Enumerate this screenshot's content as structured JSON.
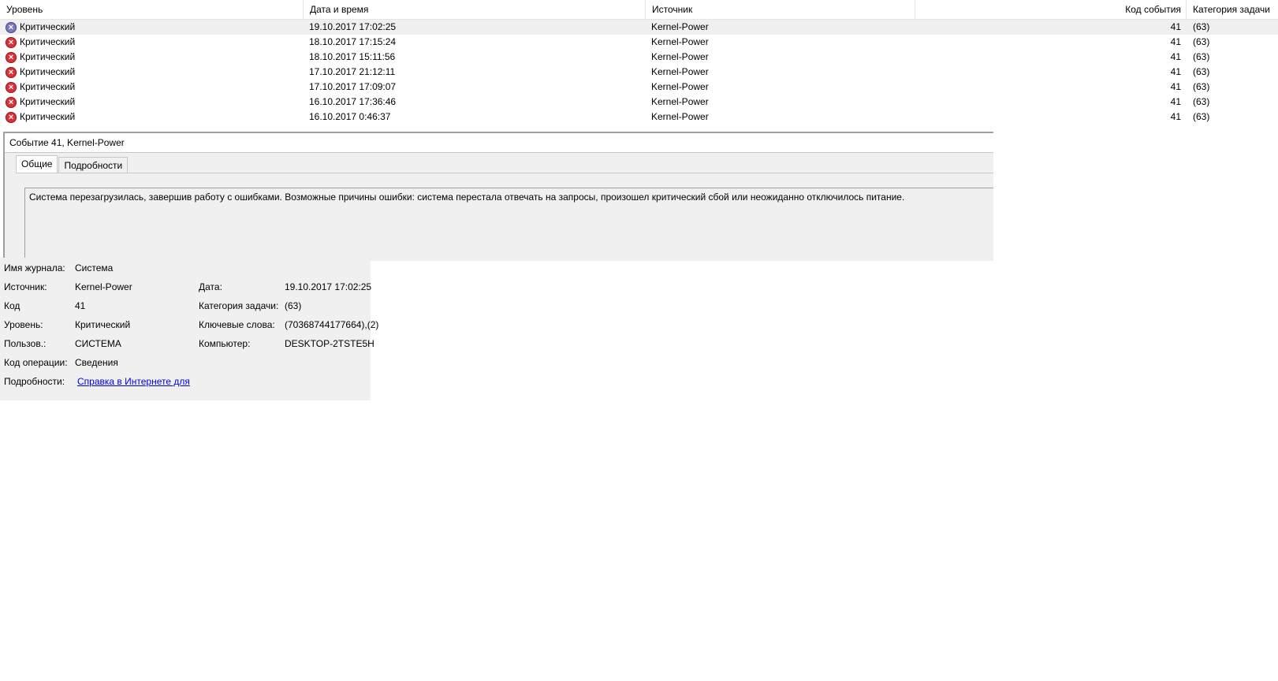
{
  "table": {
    "headers": {
      "level": "Уровень",
      "datetime": "Дата и время",
      "source": "Источник",
      "event_code": "Код события",
      "task_category": "Категория задачи"
    },
    "rows": [
      {
        "level": "Критический",
        "datetime": "19.10.2017 17:02:25",
        "source": "Kernel-Power",
        "code": "41",
        "category": "(63)"
      },
      {
        "level": "Критический",
        "datetime": "18.10.2017 17:15:24",
        "source": "Kernel-Power",
        "code": "41",
        "category": "(63)"
      },
      {
        "level": "Критический",
        "datetime": "18.10.2017 15:11:56",
        "source": "Kernel-Power",
        "code": "41",
        "category": "(63)"
      },
      {
        "level": "Критический",
        "datetime": "17.10.2017 21:12:11",
        "source": "Kernel-Power",
        "code": "41",
        "category": "(63)"
      },
      {
        "level": "Критический",
        "datetime": "17.10.2017 17:09:07",
        "source": "Kernel-Power",
        "code": "41",
        "category": "(63)"
      },
      {
        "level": "Критический",
        "datetime": "16.10.2017 17:36:46",
        "source": "Kernel-Power",
        "code": "41",
        "category": "(63)"
      },
      {
        "level": "Критический",
        "datetime": "16.10.2017 0:46:37",
        "source": "Kernel-Power",
        "code": "41",
        "category": "(63)"
      }
    ]
  },
  "details": {
    "title": "Событие 41, Kernel-Power",
    "tabs": [
      "Общие",
      "Подробности"
    ],
    "description": "Система перезагрузилась, завершив работу с ошибками. Возможные причины ошибки: система перестала отвечать на запросы, произошел критический сбой или неожиданно отключилось питание."
  },
  "properties": {
    "log_name_label": "Имя журнала:",
    "log_name": "Система",
    "source_label": "Источник:",
    "source": "Kernel-Power",
    "date_label": "Дата:",
    "date": "19.10.2017 17:02:25",
    "code_label": "Код",
    "code": "41",
    "task_category_label": "Категория задачи:",
    "task_category": "(63)",
    "level_label": "Уровень:",
    "level": "Критический",
    "keywords_label": "Ключевые слова:",
    "keywords": "(70368744177664),(2)",
    "user_label": "Пользов.:",
    "user": "СИСТЕМА",
    "computer_label": "Компьютер:",
    "computer": "DESKTOP-2TSTE5H",
    "opcode_label": "Код операции:",
    "opcode": "Сведения",
    "more_label": "Подробности:",
    "more_link": "Справка в Интернете для"
  },
  "colors": {
    "error_icon": "#d9323a",
    "selected_icon": "#7b79b8",
    "panel_bg": "#f0f0f0",
    "link": "#0000ee"
  }
}
